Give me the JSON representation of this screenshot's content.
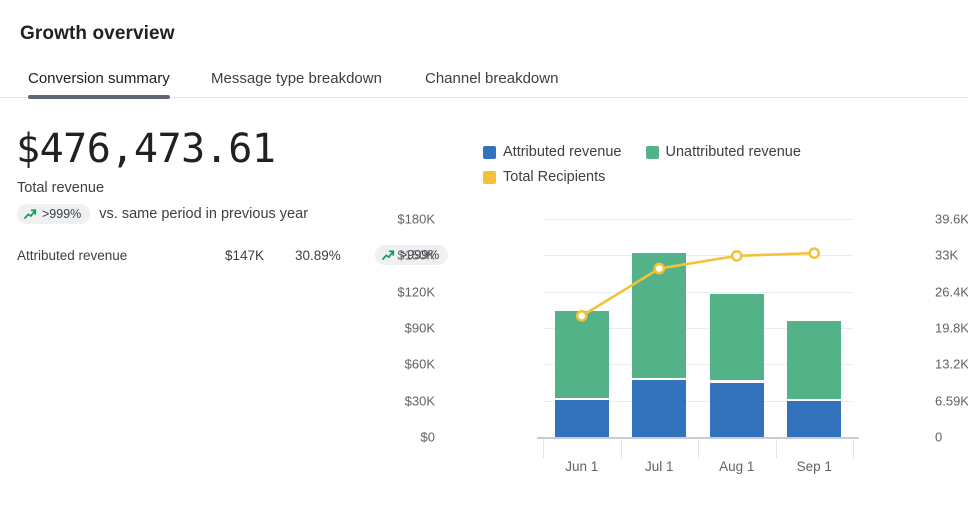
{
  "header": {
    "title": "Growth overview"
  },
  "tabs": [
    {
      "label": "Conversion summary",
      "active": true
    },
    {
      "label": "Message type breakdown",
      "active": false
    },
    {
      "label": "Channel breakdown",
      "active": false
    }
  ],
  "summary": {
    "total_value": "$476,473.61",
    "total_label": "Total revenue",
    "trend_badge": ">999%",
    "trend_icon": "trend-up-icon",
    "comparison_text": "vs. same period in previous year",
    "metric": {
      "label": "Attributed revenue",
      "value": "$147K",
      "percent": "30.89%",
      "badge": ">999%",
      "badge_icon": "trend-up-icon"
    }
  },
  "legend": [
    {
      "label": "Attributed revenue",
      "color": "#3373bd"
    },
    {
      "label": "Unattributed revenue",
      "color": "#54b289"
    },
    {
      "label": "Total Recipients",
      "color": "#f2c339"
    }
  ],
  "colors": {
    "attributed": "#3373bd",
    "unattributed": "#54b289",
    "recipients": "#f2c339",
    "grid": "#ebecee",
    "axis_text": "#5f6368",
    "accent_underline": "#5f6773"
  },
  "chart_data": {
    "type": "bar",
    "title": "",
    "xlabel": "",
    "ylabel": "",
    "categories": [
      "Jun 1",
      "Jul 1",
      "Aug 1",
      "Sep 1"
    ],
    "series": [
      {
        "name": "Attributed revenue",
        "axis": "left",
        "type": "bar",
        "stack": "revenue",
        "color": "#3373bd",
        "values": [
          30500,
          46700,
          45000,
          29700
        ]
      },
      {
        "name": "Unattributed revenue",
        "axis": "left",
        "type": "bar",
        "stack": "revenue",
        "color": "#54b289",
        "values": [
          73500,
          105300,
          73000,
          66300
        ]
      },
      {
        "name": "Total Recipients",
        "axis": "right",
        "type": "line",
        "color": "#f2c339",
        "values": [
          22000,
          30600,
          32900,
          33400
        ]
      }
    ],
    "totals": [
      104000,
      152000,
      118000,
      96000
    ],
    "y_left": {
      "ticks": [
        "$0",
        "$30K",
        "$60K",
        "$90K",
        "$120K",
        "$150K",
        "$180K"
      ],
      "values": [
        0,
        30000,
        60000,
        90000,
        120000,
        150000,
        180000
      ],
      "min": 0,
      "max": 180000
    },
    "y_right": {
      "ticks": [
        "0",
        "6.59K",
        "13.2K",
        "19.8K",
        "26.4K",
        "33K",
        "39.6K"
      ],
      "values": [
        0,
        6590,
        13200,
        19800,
        26400,
        33000,
        39600
      ],
      "min": 0,
      "max": 39600
    },
    "grid": true,
    "legend_position": "top"
  }
}
